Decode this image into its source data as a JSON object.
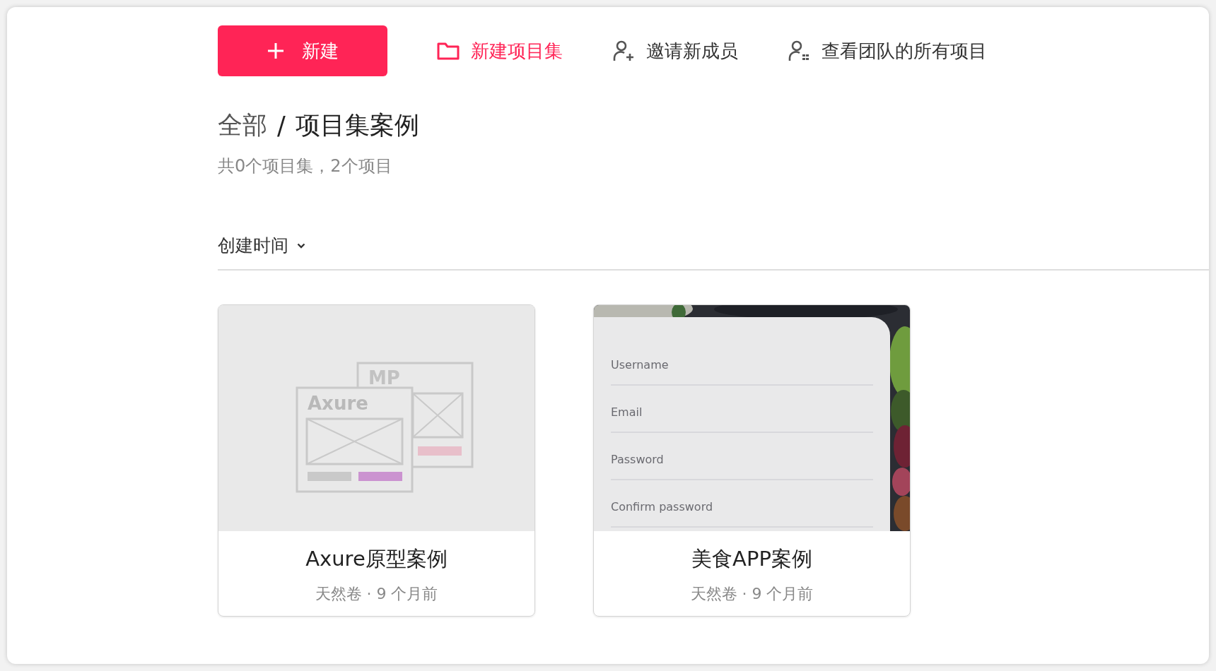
{
  "toolbar": [
    {
      "kind": "primary",
      "label": "新建"
    },
    {
      "kind": "folder",
      "label": "新建项目集"
    },
    {
      "kind": "invite",
      "label": "邀请新成员"
    },
    {
      "kind": "team",
      "label": "查看团队的所有项目"
    }
  ],
  "breadcrumb": [
    {
      "label": "全部",
      "selected": false
    },
    {
      "label": "项目集案例",
      "selected": true
    }
  ],
  "breadcrumb_separator": "/",
  "summary": "共0个项目集，2个项目",
  "sort": {
    "label": "创建时间"
  },
  "cards": [
    {
      "kind": "axure-illustration",
      "title": "Axure原型案例",
      "meta": "天然卷 · 9 个月前",
      "thumbnail_texts": [
        "MP",
        "Axure"
      ]
    },
    {
      "kind": "app-form",
      "title": "美食APP案例",
      "meta": "天然卷 · 9 个月前",
      "fields": [
        "Username",
        "Email",
        "Password",
        "Confirm password"
      ]
    }
  ]
}
